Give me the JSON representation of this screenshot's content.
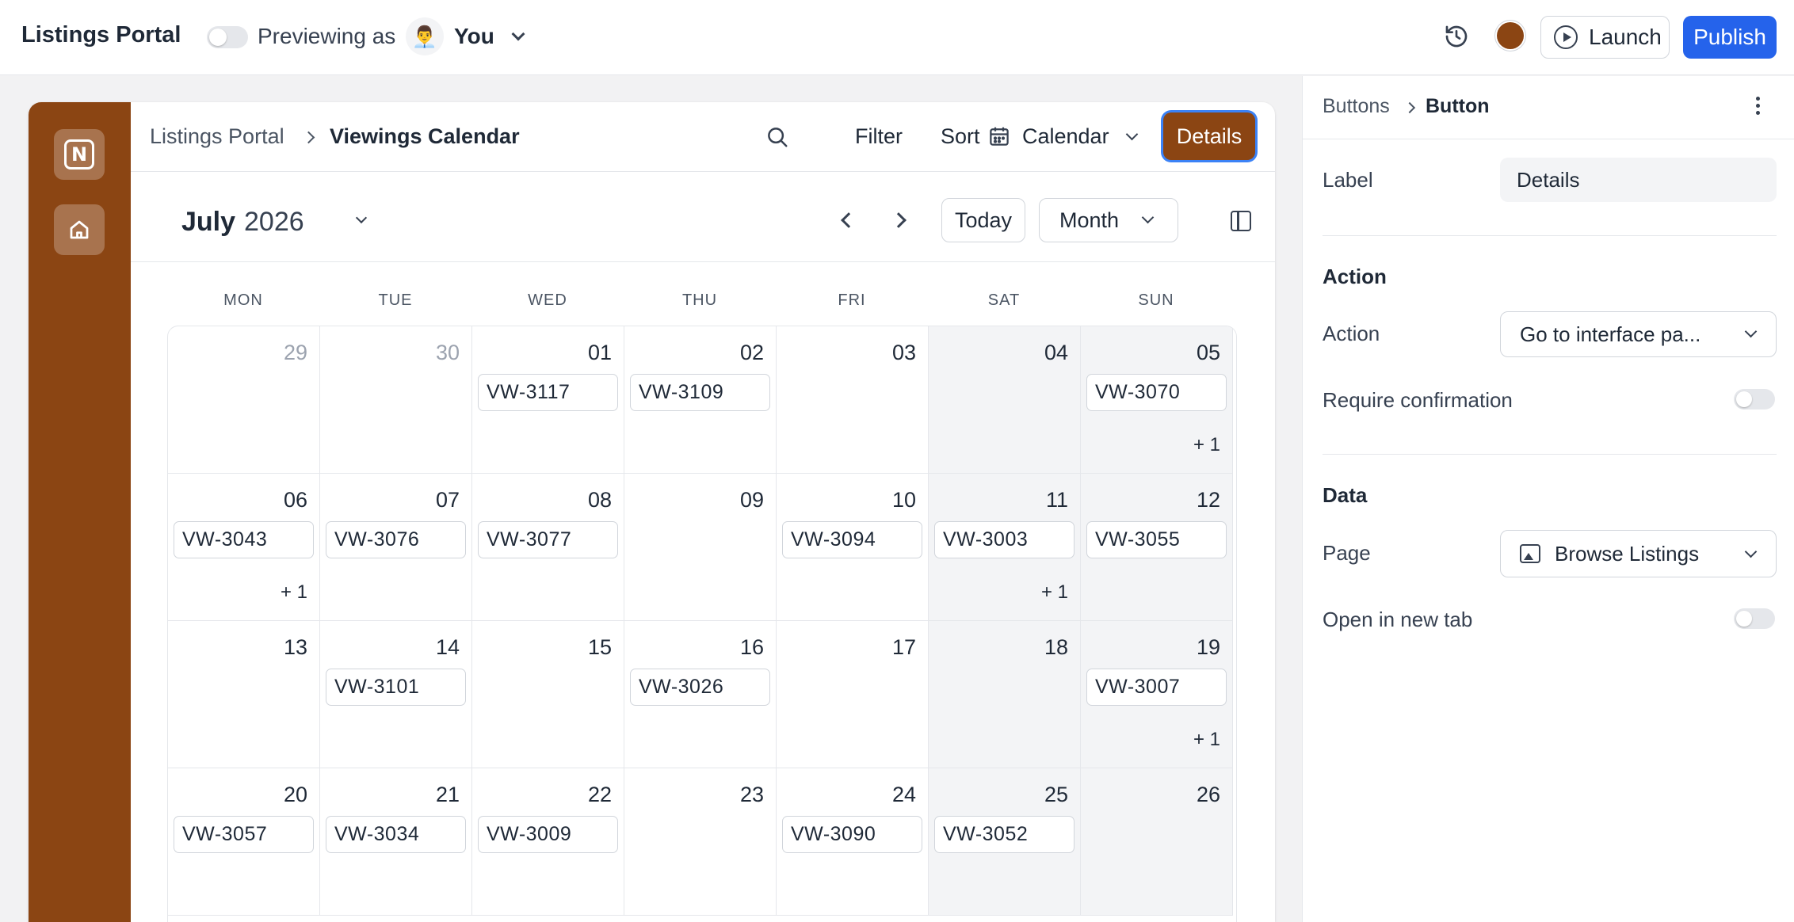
{
  "topbar": {
    "app_title": "Listings Portal",
    "preview_label": "Previewing as",
    "preview_avatar": "👨‍💼",
    "preview_user": "You",
    "launch_label": "Launch",
    "publish_label": "Publish",
    "brand_color": "#8B4513",
    "publish_color": "#2563EB"
  },
  "app": {
    "sidebar_color": "#8B4513",
    "logo_text": "N",
    "breadcrumb": [
      "Listings Portal",
      "Viewings Calendar"
    ],
    "toolbar": {
      "filter_label": "Filter",
      "sort_label": "Sort",
      "view_label": "Calendar",
      "details_label": "Details"
    },
    "calendar": {
      "month": "July",
      "year": "2026",
      "today_label": "Today",
      "view_mode": "Month",
      "weekdays": [
        "MON",
        "TUE",
        "WED",
        "THU",
        "FRI",
        "SAT",
        "SUN"
      ],
      "weeks": [
        [
          {
            "day": "29",
            "muted": true,
            "events": [],
            "more": ""
          },
          {
            "day": "30",
            "muted": true,
            "events": [],
            "more": ""
          },
          {
            "day": "01",
            "events": [
              "VW-3117"
            ],
            "more": ""
          },
          {
            "day": "02",
            "events": [
              "VW-3109"
            ],
            "more": ""
          },
          {
            "day": "03",
            "events": [],
            "more": ""
          },
          {
            "day": "04",
            "events": [],
            "more": ""
          },
          {
            "day": "05",
            "events": [
              "VW-3070"
            ],
            "more": "+ 1"
          }
        ],
        [
          {
            "day": "06",
            "events": [
              "VW-3043"
            ],
            "more": "+ 1"
          },
          {
            "day": "07",
            "events": [
              "VW-3076"
            ],
            "more": ""
          },
          {
            "day": "08",
            "events": [
              "VW-3077"
            ],
            "more": ""
          },
          {
            "day": "09",
            "events": [],
            "more": ""
          },
          {
            "day": "10",
            "events": [
              "VW-3094"
            ],
            "more": ""
          },
          {
            "day": "11",
            "events": [
              "VW-3003"
            ],
            "more": "+ 1"
          },
          {
            "day": "12",
            "events": [
              "VW-3055"
            ],
            "more": ""
          }
        ],
        [
          {
            "day": "13",
            "events": [],
            "more": ""
          },
          {
            "day": "14",
            "events": [
              "VW-3101"
            ],
            "more": ""
          },
          {
            "day": "15",
            "events": [],
            "more": ""
          },
          {
            "day": "16",
            "events": [
              "VW-3026"
            ],
            "more": ""
          },
          {
            "day": "17",
            "events": [],
            "more": ""
          },
          {
            "day": "18",
            "events": [],
            "more": ""
          },
          {
            "day": "19",
            "events": [
              "VW-3007"
            ],
            "more": "+ 1"
          }
        ],
        [
          {
            "day": "20",
            "events": [
              "VW-3057"
            ],
            "more": ""
          },
          {
            "day": "21",
            "events": [
              "VW-3034"
            ],
            "more": ""
          },
          {
            "day": "22",
            "events": [
              "VW-3009"
            ],
            "more": ""
          },
          {
            "day": "23",
            "events": [],
            "more": ""
          },
          {
            "day": "24",
            "events": [
              "VW-3090"
            ],
            "more": ""
          },
          {
            "day": "25",
            "events": [
              "VW-3052"
            ],
            "more": ""
          },
          {
            "day": "26",
            "events": [],
            "more": ""
          }
        ]
      ]
    }
  },
  "props": {
    "breadcrumb": [
      "Buttons",
      "Button"
    ],
    "label_label": "Label",
    "label_value": "Details",
    "action_section": "Action",
    "action_label": "Action",
    "action_value": "Go to interface pa...",
    "confirm_label": "Require confirmation",
    "data_section": "Data",
    "page_label": "Page",
    "page_value": "Browse Listings",
    "newtab_label": "Open in new tab"
  }
}
